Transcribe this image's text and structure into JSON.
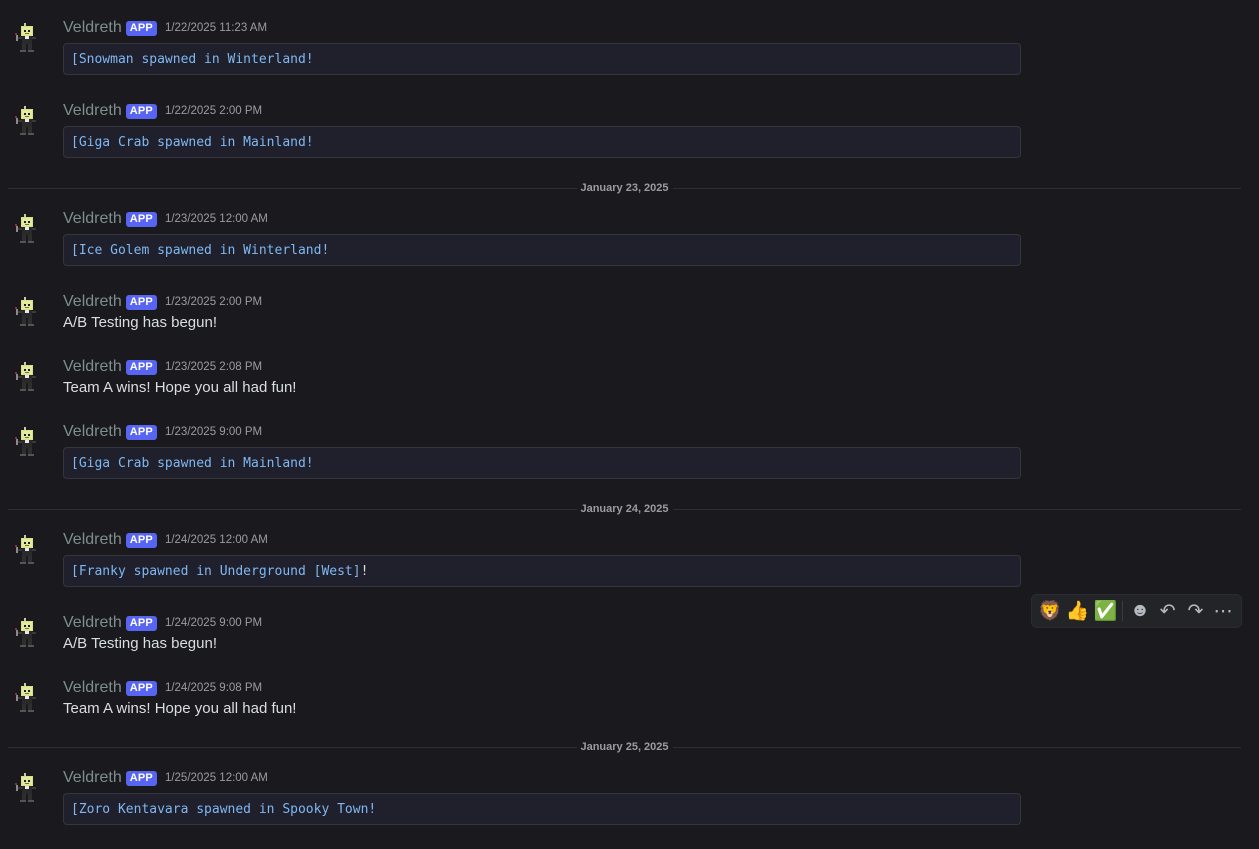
{
  "messages": [
    {
      "username": "Veldreth",
      "tag": "APP",
      "timestamp": "1/22/2025 11:23 AM",
      "kind": "code",
      "hl": "[Snowman spawned in Winterland!",
      "rest": ""
    },
    {
      "username": "Veldreth",
      "tag": "APP",
      "timestamp": "1/22/2025 2:00 PM",
      "kind": "code",
      "hl": "[Giga Crab spawned in Mainland!",
      "rest": ""
    },
    {
      "username": "Veldreth",
      "tag": "APP",
      "timestamp": "1/23/2025 12:00 AM",
      "kind": "code",
      "hl": "[Ice Golem spawned in Winterland!",
      "rest": ""
    },
    {
      "username": "Veldreth",
      "tag": "APP",
      "timestamp": "1/23/2025 2:00 PM",
      "kind": "text",
      "text": "A/B Testing has begun!"
    },
    {
      "username": "Veldreth",
      "tag": "APP",
      "timestamp": "1/23/2025 2:08 PM",
      "kind": "text",
      "text": "Team A wins! Hope you all had fun!"
    },
    {
      "username": "Veldreth",
      "tag": "APP",
      "timestamp": "1/23/2025 9:00 PM",
      "kind": "code",
      "hl": "[Giga Crab spawned in Mainland!",
      "rest": ""
    },
    {
      "username": "Veldreth",
      "tag": "APP",
      "timestamp": "1/24/2025 12:00 AM",
      "kind": "code",
      "hl": "[Franky spawned in Underground [West]",
      "rest": "!"
    },
    {
      "username": "Veldreth",
      "tag": "APP",
      "timestamp": "1/24/2025 9:00 PM",
      "kind": "text",
      "text": "A/B Testing has begun!"
    },
    {
      "username": "Veldreth",
      "tag": "APP",
      "timestamp": "1/24/2025 9:08 PM",
      "kind": "text",
      "text": "Team A wins! Hope you all had fun!"
    },
    {
      "username": "Veldreth",
      "tag": "APP",
      "timestamp": "1/25/2025 12:00 AM",
      "kind": "code",
      "hl": "[Zoro Kentavara spawned in Spooky Town!",
      "rest": ""
    }
  ],
  "dividers": [
    {
      "label": "January 23, 2025"
    },
    {
      "label": "January 24, 2025"
    },
    {
      "label": "January 25, 2025"
    }
  ],
  "toolbar": {
    "reactions": [
      {
        "name": "lion-emoji",
        "glyph": "🦁"
      },
      {
        "name": "thumbs-up-emoji",
        "glyph": "👍"
      },
      {
        "name": "check-mark-emoji",
        "glyph": "✅"
      }
    ],
    "actions": [
      {
        "name": "add-reaction-icon",
        "glyph": "☻"
      },
      {
        "name": "reply-icon",
        "glyph": "↶"
      },
      {
        "name": "forward-icon",
        "glyph": "↷"
      },
      {
        "name": "more-options-icon",
        "glyph": "⋯"
      }
    ]
  },
  "colors": {
    "background": "#1a1a1e",
    "username": "#7d8f8c",
    "app_tag": "#5865f2",
    "code_text": "#7fb7f2",
    "body_text": "#dbdee1"
  }
}
